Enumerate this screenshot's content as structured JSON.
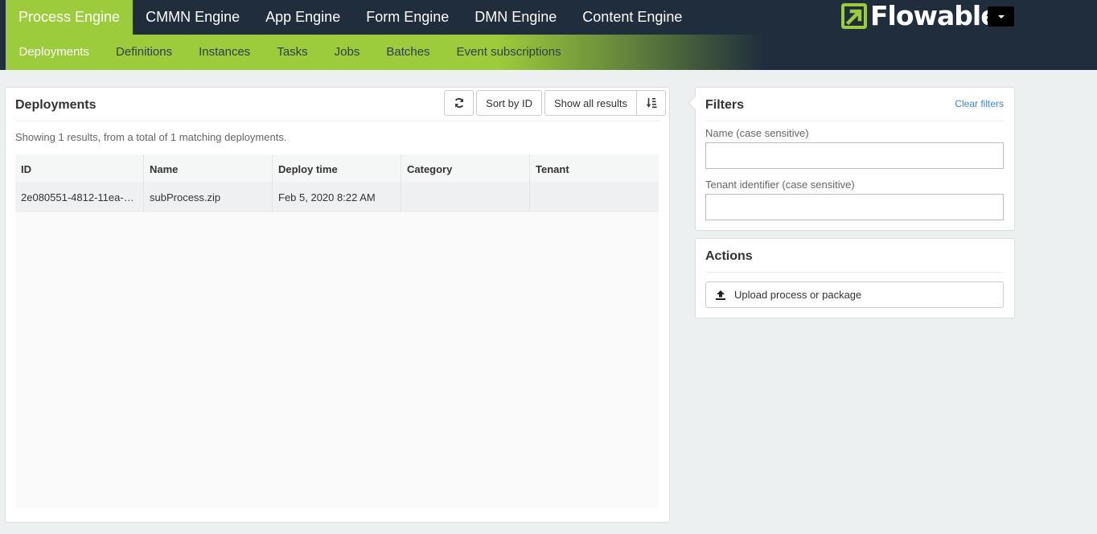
{
  "engines": [
    {
      "label": "Process Engine",
      "active": true
    },
    {
      "label": "CMMN Engine",
      "active": false
    },
    {
      "label": "App Engine",
      "active": false
    },
    {
      "label": "Form Engine",
      "active": false
    },
    {
      "label": "DMN Engine",
      "active": false
    },
    {
      "label": "Content Engine",
      "active": false
    }
  ],
  "logo": {
    "text": "Flowable"
  },
  "subnav": [
    {
      "label": "Deployments",
      "active": true
    },
    {
      "label": "Definitions",
      "active": false
    },
    {
      "label": "Instances",
      "active": false
    },
    {
      "label": "Tasks",
      "active": false
    },
    {
      "label": "Jobs",
      "active": false
    },
    {
      "label": "Batches",
      "active": false
    },
    {
      "label": "Event subscriptions",
      "active": false
    }
  ],
  "deployments": {
    "title": "Deployments",
    "toolbar": {
      "refresh_icon": "refresh-icon",
      "sort_label": "Sort by ID",
      "show_all_label": "Show all results",
      "sort_order_icon": "sort-ascending-icon"
    },
    "summary": "Showing 1 results, from a total of 1 matching deployments.",
    "columns": [
      "ID",
      "Name",
      "Deploy time",
      "Category",
      "Tenant"
    ],
    "rows": [
      [
        "2e080551-4812-11ea-…",
        "subProcess.zip",
        "Feb 5, 2020 8:22 AM",
        "",
        ""
      ]
    ]
  },
  "filters": {
    "title": "Filters",
    "clear_label": "Clear filters",
    "name_label": "Name (case sensitive)",
    "name_value": "",
    "tenant_label": "Tenant identifier (case sensitive)",
    "tenant_value": ""
  },
  "actions": {
    "title": "Actions",
    "upload_label": "Upload process or package",
    "upload_icon": "upload-icon"
  },
  "colors": {
    "nav_bg": "#1f2d3d",
    "accent_green": "#9ccb3b",
    "link_blue": "#3a87c8"
  }
}
